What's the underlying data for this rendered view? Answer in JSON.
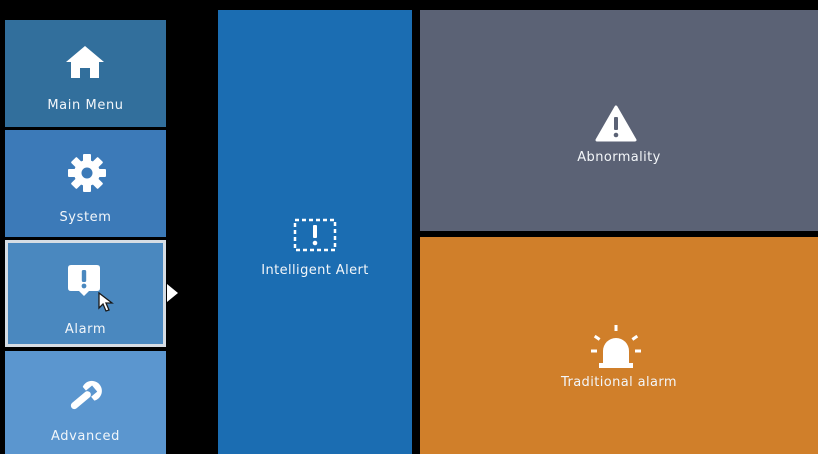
{
  "sidebar": {
    "items": [
      {
        "label": "Main Menu",
        "icon": "home-icon"
      },
      {
        "label": "System",
        "icon": "gear-icon"
      },
      {
        "label": "Alarm",
        "icon": "alert-badge-icon",
        "selected": true
      },
      {
        "label": "Advanced",
        "icon": "wrench-icon"
      }
    ]
  },
  "tiles": {
    "intelligent_alert": {
      "label": "Intelligent Alert",
      "icon": "intelligent-alert-icon",
      "color": "#1b6db2"
    },
    "abnormality": {
      "label": "Abnormality",
      "icon": "warning-triangle-icon",
      "color": "#5b6275"
    },
    "traditional_alarm": {
      "label": "Traditional alarm",
      "icon": "siren-icon",
      "color": "#d07f2a"
    }
  },
  "colors": {
    "sidebar_main": "#326f9c",
    "sidebar_system": "#3c7ab8",
    "sidebar_alarm": "#4a88bf",
    "sidebar_advanced": "#5b96cf",
    "background": "#000000"
  }
}
